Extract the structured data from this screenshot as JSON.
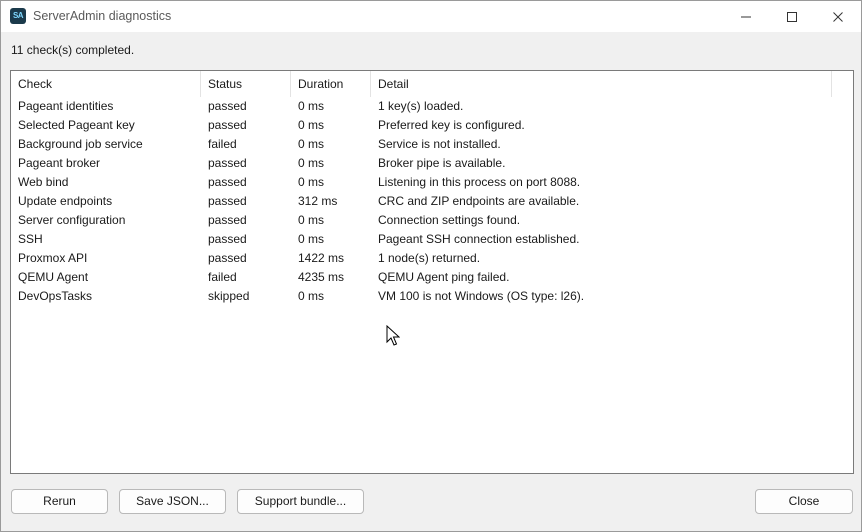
{
  "window": {
    "title": "ServerAdmin diagnostics",
    "app_icon_text": "SA"
  },
  "summary": "11 check(s) completed.",
  "table": {
    "columns": [
      "Check",
      "Status",
      "Duration",
      "Detail"
    ],
    "rows": [
      {
        "check": "Pageant identities",
        "status": "passed",
        "duration": "0 ms",
        "detail": "1 key(s) loaded."
      },
      {
        "check": "Selected Pageant key",
        "status": "passed",
        "duration": "0 ms",
        "detail": "Preferred key is configured."
      },
      {
        "check": "Background job service",
        "status": "failed",
        "duration": "0 ms",
        "detail": "Service is not installed."
      },
      {
        "check": "Pageant broker",
        "status": "passed",
        "duration": "0 ms",
        "detail": "Broker pipe is available."
      },
      {
        "check": "Web bind",
        "status": "passed",
        "duration": "0 ms",
        "detail": "Listening in this process on port 8088."
      },
      {
        "check": "Update endpoints",
        "status": "passed",
        "duration": "312 ms",
        "detail": "CRC and ZIP endpoints are available."
      },
      {
        "check": "Server configuration",
        "status": "passed",
        "duration": "0 ms",
        "detail": "Connection settings found."
      },
      {
        "check": "SSH",
        "status": "passed",
        "duration": "0 ms",
        "detail": "Pageant SSH connection established."
      },
      {
        "check": "Proxmox API",
        "status": "passed",
        "duration": "1422 ms",
        "detail": "1 node(s) returned."
      },
      {
        "check": "QEMU Agent",
        "status": "failed",
        "duration": "4235 ms",
        "detail": "QEMU Agent ping failed."
      },
      {
        "check": "DevOpsTasks",
        "status": "skipped",
        "duration": "0 ms",
        "detail": "VM 100 is not Windows (OS type: l26)."
      }
    ]
  },
  "buttons": {
    "rerun": "Rerun",
    "save_json": "Save JSON...",
    "support_bundle": "Support bundle...",
    "close": "Close"
  }
}
